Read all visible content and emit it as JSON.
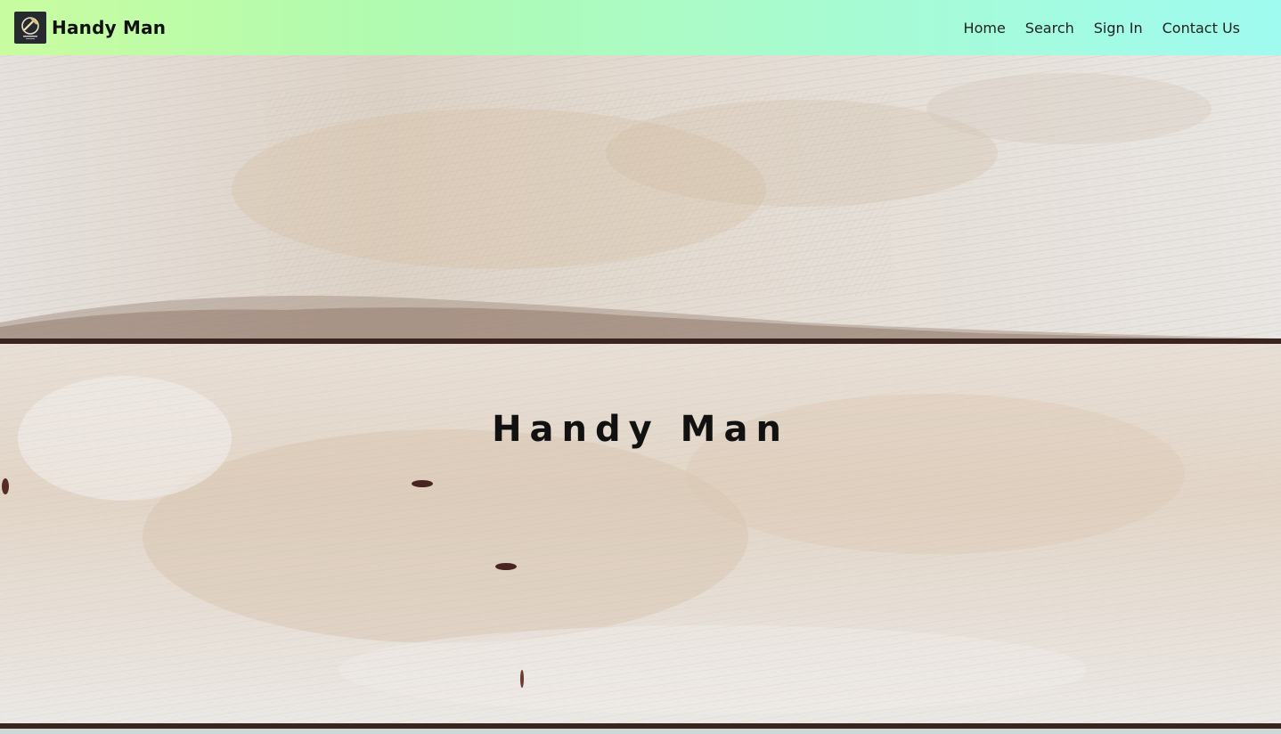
{
  "brand": {
    "name": "Handy Man",
    "logo_icon": "hammer-logo-icon"
  },
  "nav": {
    "items": [
      {
        "label": "Home"
      },
      {
        "label": "Search"
      },
      {
        "label": "Sign In"
      },
      {
        "label": "Contact Us"
      }
    ]
  },
  "hero": {
    "title": "Handy Man",
    "background": "whitewashed-wood-planks"
  },
  "colors": {
    "nav_gradient_start": "#c9fca0",
    "nav_gradient_end": "#9ffbf0",
    "wood_white": "#ece8e4",
    "wood_tan": "#d9c2a6",
    "plank_gap": "#3a2420"
  }
}
